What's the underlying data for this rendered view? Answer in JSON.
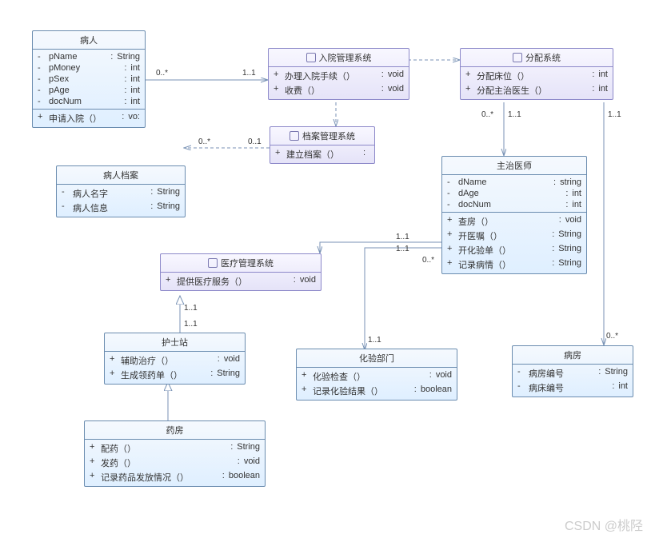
{
  "classes": {
    "patient": {
      "title": "病人",
      "attrs": [
        {
          "vis": "-",
          "name": "pName",
          "type": "String"
        },
        {
          "vis": "-",
          "name": "pMoney",
          "type": "int"
        },
        {
          "vis": "-",
          "name": "pSex",
          "type": "int"
        },
        {
          "vis": "-",
          "name": "pAge",
          "type": "int"
        },
        {
          "vis": "-",
          "name": "docNum",
          "type": "int"
        }
      ],
      "methods": [
        {
          "vis": "+",
          "name": "申请入院（）",
          "type": "vo:"
        }
      ]
    },
    "admission_sys": {
      "title": "入院管理系统",
      "methods": [
        {
          "vis": "+",
          "name": "办理入院手续（）",
          "type": "void"
        },
        {
          "vis": "+",
          "name": "收费（）",
          "type": "void"
        }
      ]
    },
    "alloc_sys": {
      "title": "分配系统",
      "methods": [
        {
          "vis": "+",
          "name": "分配床位（）",
          "type": "int"
        },
        {
          "vis": "+",
          "name": "分配主治医生（）",
          "type": "int"
        }
      ]
    },
    "archive_sys": {
      "title": "档案管理系统",
      "methods": [
        {
          "vis": "+",
          "name": "建立档案（）",
          "type": ""
        }
      ]
    },
    "patient_archive": {
      "title": "病人档案",
      "attrs": [
        {
          "vis": "-",
          "name": "病人名字",
          "type": "String"
        },
        {
          "vis": "-",
          "name": "病人信息",
          "type": "String"
        }
      ]
    },
    "doctor": {
      "title": "主治医师",
      "attrs": [
        {
          "vis": "-",
          "name": "dName",
          "type": "string"
        },
        {
          "vis": "-",
          "name": "dAge",
          "type": "int"
        },
        {
          "vis": "-",
          "name": "docNum",
          "type": "int"
        }
      ],
      "methods": [
        {
          "vis": "+",
          "name": "查房（）",
          "type": "void"
        },
        {
          "vis": "+",
          "name": "开医嘱（）",
          "type": "String"
        },
        {
          "vis": "+",
          "name": "开化验单（）",
          "type": "String"
        },
        {
          "vis": "+",
          "name": "记录病情（）",
          "type": "String"
        }
      ]
    },
    "medical_sys": {
      "title": "医疗管理系统",
      "methods": [
        {
          "vis": "+",
          "name": "提供医疗服务（）",
          "type": "void"
        }
      ]
    },
    "nurse_station": {
      "title": "护士站",
      "methods": [
        {
          "vis": "+",
          "name": "辅助治疗（）",
          "type": "void"
        },
        {
          "vis": "+",
          "name": "生成领药单（）",
          "type": "String"
        }
      ]
    },
    "lab_dept": {
      "title": "化验部门",
      "methods": [
        {
          "vis": "+",
          "name": "化验检查（）",
          "type": "void"
        },
        {
          "vis": "+",
          "name": "记录化验结果（）",
          "type": "boolean"
        }
      ]
    },
    "ward": {
      "title": "病房",
      "attrs": [
        {
          "vis": "-",
          "name": "病房编号",
          "type": "String"
        },
        {
          "vis": "-",
          "name": "病床编号",
          "type": "int"
        }
      ]
    },
    "pharmacy": {
      "title": "药房",
      "methods": [
        {
          "vis": "+",
          "name": "配药（）",
          "type": "String"
        },
        {
          "vis": "+",
          "name": "发药（）",
          "type": "void"
        },
        {
          "vis": "+",
          "name": "记录药品发放情况（）",
          "type": "boolean"
        }
      ]
    }
  },
  "labels": {
    "m01": "0..*",
    "m02": "1..1",
    "m03": "0..*",
    "m04": "0..1",
    "m05": "0..*",
    "m06": "1..1",
    "m07": "1..1",
    "m08": "0..*",
    "m09": "1..1",
    "m10": "1..1",
    "m11": "0..*",
    "m12": "1..1",
    "m13": "1..1",
    "m14": "1..1"
  },
  "watermark": "CSDN @桃陉"
}
